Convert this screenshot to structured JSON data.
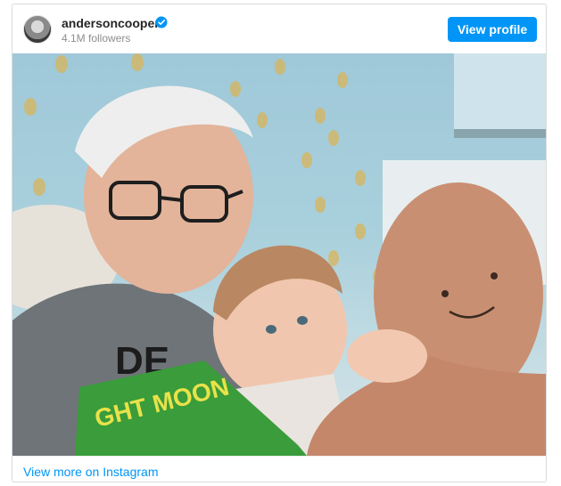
{
  "header": {
    "username": "andersoncooper",
    "followers": "4.1M followers",
    "view_profile_label": "View profile"
  },
  "photo": {
    "alt": "Man with glasses kissing toddler's head while holding a book and a plush octopus"
  },
  "footer": {
    "view_more_label": "View more on Instagram"
  },
  "colors": {
    "accent": "#0095f6",
    "border": "#dbdbdb",
    "muted": "#8e8e8e"
  }
}
